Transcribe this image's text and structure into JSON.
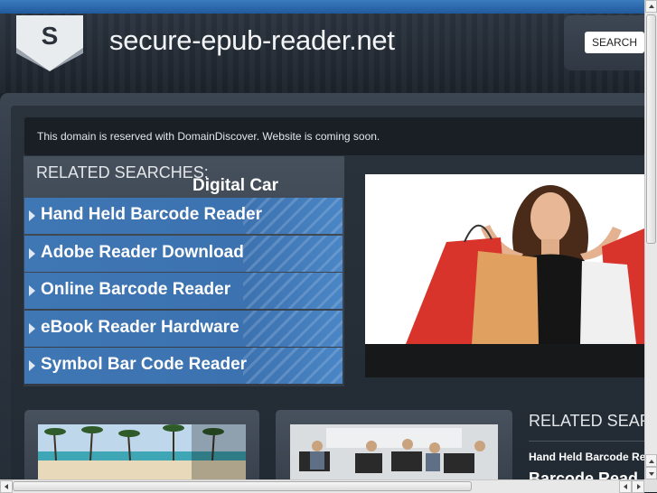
{
  "header": {
    "logo_letter": "S",
    "site_title": "secure-epub-reader.net",
    "search_label": "SEARCH"
  },
  "notice": {
    "text": "This domain is reserved with DomainDiscover. Website is coming soon."
  },
  "related_searches": {
    "title": "RELATED SEARCHES:",
    "items": [
      {
        "label": "Hand Held Barcode Reader"
      },
      {
        "label": "Adobe Reader Download"
      },
      {
        "label": "Online Barcode Reader"
      },
      {
        "label": "eBook Reader Hardware"
      },
      {
        "label": "Symbol Bar Code Reader"
      }
    ]
  },
  "promo": {
    "caption": "Digital Car"
  },
  "related_searches_2": {
    "title": "RELATED SEAR",
    "items": [
      {
        "label": "Hand Held Barcode Rea"
      },
      {
        "label": "Barcode Read"
      }
    ]
  },
  "colors": {
    "accent_blue": "#3c72b0",
    "top_bar": "#2b6cb0",
    "dark_bg": "#1d2229"
  },
  "icons": {
    "logo": "shield-logo-icon",
    "list_arrow": "triangle-right-icon"
  }
}
